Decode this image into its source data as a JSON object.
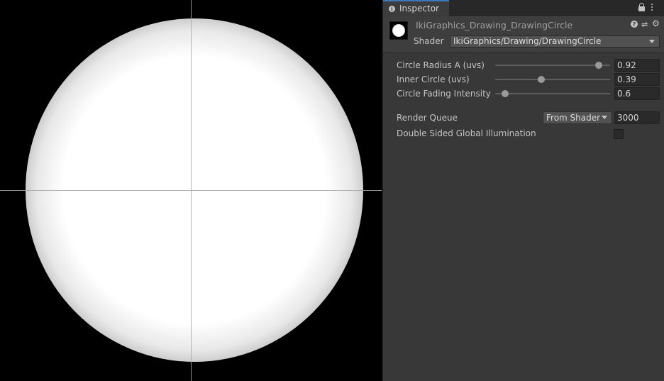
{
  "tab": {
    "label": "Inspector",
    "icon": "info-icon"
  },
  "tabbar_icons": [
    "lock-icon",
    "kebab-menu-icon"
  ],
  "material": {
    "name": "IkiGraphics_Drawing_DrawingCircle",
    "shader_label": "Shader",
    "shader_value": "IkiGraphics/Drawing/DrawingCircle",
    "header_icons": [
      "help-icon",
      "preset-icon",
      "settings-icon"
    ]
  },
  "properties": [
    {
      "label": "Circle Radius A (uvs)",
      "value": "0.92",
      "fraction": 0.92
    },
    {
      "label": "Inner Circle (uvs)",
      "value": "0.39",
      "fraction": 0.39
    },
    {
      "label": "Circle Fading Intensity",
      "value": "0.6",
      "fraction": 0.06
    }
  ],
  "render_queue": {
    "label": "Render Queue",
    "mode": "From Shader",
    "value": "3000"
  },
  "double_sided_gi": {
    "label": "Double Sided Global Illumination",
    "checked": false
  },
  "colors": {
    "accent": "#3a79bb",
    "panel": "#383838",
    "field": "#2a2a2a"
  }
}
